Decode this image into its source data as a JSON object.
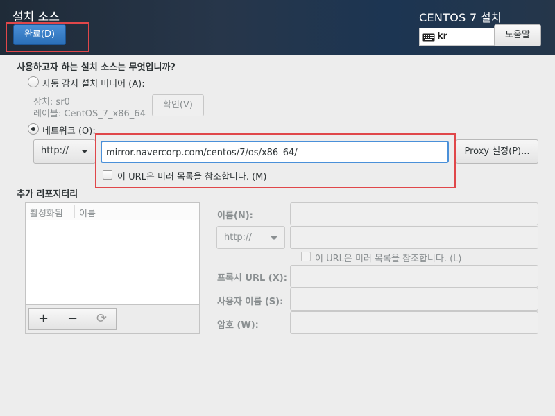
{
  "header": {
    "title": "설치 소스",
    "done_label": "완료(D)",
    "product": "CENTOS 7 설치",
    "keyboard_layout": "kr",
    "help_label": "도움말"
  },
  "source": {
    "question": "사용하고자 하는 설치 소스는 무엇입니까?",
    "auto_label": "자동 감지 설치 미디어 (A):",
    "device_line": "장치: sr0",
    "label_line": "레이블: CentOS_7_x86_64",
    "verify_label": "확인(V)",
    "network_label": "네트워크 (O):",
    "protocol": "http://",
    "url_value": "mirror.navercorp.com/centos/7/os/x86_64/",
    "mirror_check_label": "이 URL은 미러 목록을 참조합니다. (M)",
    "proxy_label": "Proxy 설정(P)..."
  },
  "repos": {
    "title": "추가 리포지터리",
    "columns": [
      "활성화됨",
      "이름"
    ],
    "add_symbol": "+",
    "remove_symbol": "−",
    "refresh_symbol": "⟳"
  },
  "repo_form": {
    "name_label": "이름(N):",
    "protocol": "http://",
    "mirror_label": "이 URL은 미러 목록을 참조합니다. (L)",
    "proxy_url_label": "프록시 URL (X):",
    "username_label": "사용자 이름 (S):",
    "password_label": "암호 (W):"
  }
}
